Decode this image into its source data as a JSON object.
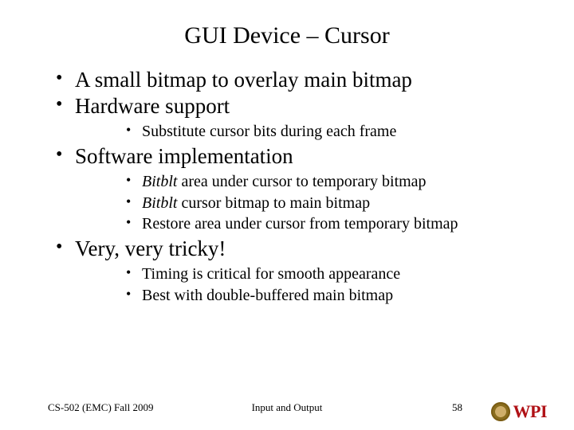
{
  "title": "GUI Device – Cursor",
  "bullets": {
    "b0": "A small bitmap to overlay main bitmap",
    "b1": "Hardware support",
    "b1s": {
      "a": "Substitute cursor bits during each frame"
    },
    "b2": "Software implementation",
    "b2s": {
      "a_italic": "Bitblt",
      "a_rest": " area under cursor to temporary bitmap",
      "b_italic": "Bitblt",
      "b_rest": " cursor bitmap to main bitmap",
      "c": "Restore area under cursor from temporary bitmap"
    },
    "b3": "Very, very tricky!",
    "b3s": {
      "a": "Timing is critical for smooth appearance",
      "b": "Best with double-buffered main bitmap"
    }
  },
  "footer": {
    "left": "CS-502 (EMC) Fall 2009",
    "center": "Input and Output",
    "pagenum": "58",
    "logo_text": "WPI"
  }
}
